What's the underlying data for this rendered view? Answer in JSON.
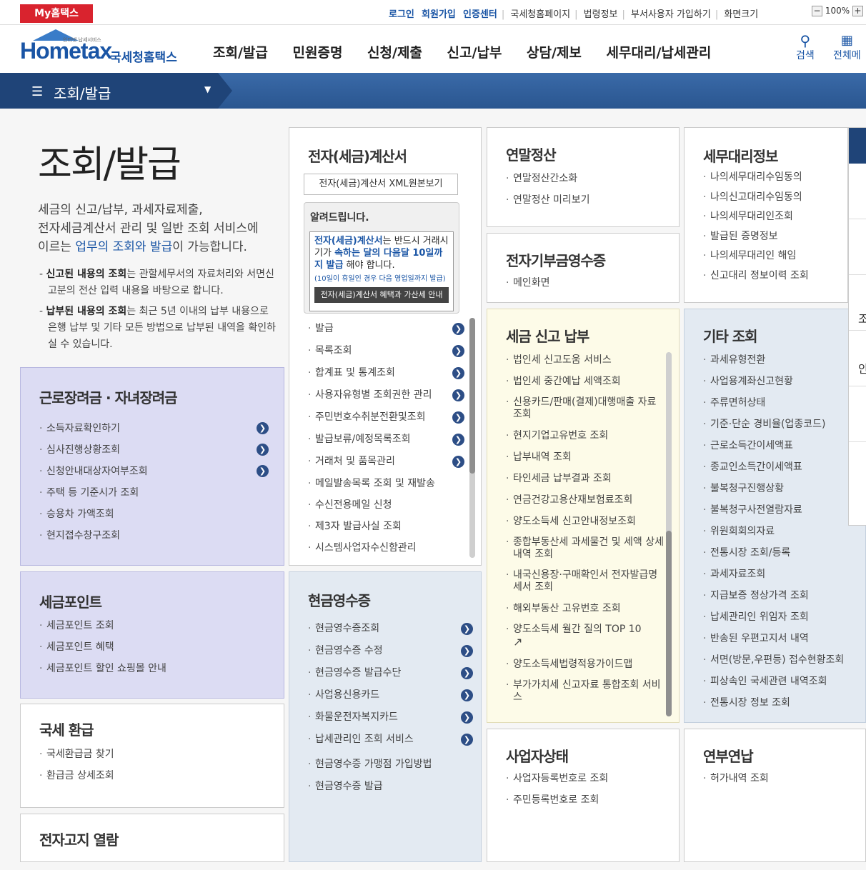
{
  "topbar": {
    "my": "My홈택스",
    "links": [
      "로그인",
      "회원가입",
      "인증센터",
      "국세청홈페이지",
      "법령정보",
      "부서사용자 가입하기",
      "화면크기"
    ],
    "zoom": "100%"
  },
  "logo": {
    "home": "Hometax",
    "sub": "인터넷 납세서비스",
    "kor": "국세청홈택스"
  },
  "nav": [
    "조회/발급",
    "민원증명",
    "신청/제출",
    "신고/납부",
    "상담/제보",
    "세무대리/납세관리"
  ],
  "search_label": "검색",
  "allmenu_label": "전체메",
  "section_title": "조회/발급",
  "intro": {
    "title": "조회/발급",
    "desc_1": "세금의 신고/납부, 과세자료제출,",
    "desc_2": "전자세금계산서 관리 및 일반 조회 서비스에",
    "desc_3a": "이르는 ",
    "desc_3b": "업무의 조회와 발급",
    "desc_3c": "이 가능합니다.",
    "note1_b": "신고된 내용의 조회",
    "note1_t": "는 관할세무서의 자료처리와 서면신고분의 전산 입력 내용을 바탕으로 합니다.",
    "note2_b": "납부된 내용의 조회",
    "note2_t": "는 최근 5년 이내의 납부 내용으로 은행 납부 및 기타 모든 방법으로 납부된 내역을 확인하실 수 있습니다."
  },
  "boxes": {
    "labor": {
      "title": "근로장려금 · 자녀장려금",
      "items": [
        "소득자료확인하기",
        "심사진행상황조회",
        "신청안내대상자여부조회",
        "주택 등 기준시가 조회",
        "승용차 가액조회",
        "현지접수창구조회"
      ]
    },
    "point": {
      "title": "세금포인트",
      "items": [
        "세금포인트 조회",
        "세금포인트 혜택",
        "세금포인트 할인 쇼핑몰 안내"
      ]
    },
    "refund": {
      "title": "국세 환급",
      "items": [
        "국세환급금 찾기",
        "환급금 상세조회"
      ]
    },
    "enotice": {
      "title": "전자고지 열람"
    },
    "einvoice": {
      "title": "전자(세금)계산서",
      "xml_btn": "전자(세금)계산서 XML원본보기",
      "notice_title": "알려드립니다.",
      "notice_body_a": "전자(세금)계산서",
      "notice_body_b": "는 반드시 거래시기가 ",
      "notice_body_c": "속하는 달의 다음달 10일까지 발급",
      "notice_body_d": " 해야 합니다.",
      "notice_small": "(10일이 휴일인 경우 다음 영업일까지 발급)",
      "notice_btn": "전자(세금)계산서 혜택과 가산세 안내",
      "items": [
        "발급",
        "목록조회",
        "합계표 및 통계조회",
        "사용자유형별 조회권한 관리",
        "주민번호수취분전환및조회",
        "발급보류/예정목록조회",
        "거래처 및 품목관리",
        "메일발송목록 조회 및 재발송",
        "수신전용메일 신청",
        "제3자 발급사실 조회",
        "시스템사업자수신함관리"
      ]
    },
    "cash": {
      "title": "현금영수증",
      "items": [
        "현금영수증조회",
        "현금영수증 수정",
        "현금영수증 발급수단",
        "사업용신용카드",
        "화물운전자복지카드",
        "납세관리인 조회 서비스",
        "현금영수증 가맹점 가입방법",
        "현금영수증 발급"
      ]
    },
    "yearend": {
      "title": "연말정산",
      "items": [
        "연말정산간소화",
        "연말정산 미리보기"
      ]
    },
    "donation": {
      "title": "전자기부금영수증",
      "items": [
        "메인화면"
      ]
    },
    "taxreport": {
      "title": "세금 신고 납부",
      "items": [
        "법인세 신고도움 서비스",
        "법인세 중간예납 세액조회",
        "신용카드/판매(결제)대행매출 자료조회",
        "현지기업고유번호 조회",
        "납부내역 조회",
        "타인세금 납부결과 조회",
        "연금건강고용산재보험료조회",
        "양도소득세 신고안내정보조회",
        "종합부동산세 과세물건 및 세액 상세내역 조회",
        "내국신용장·구매확인서 전자발급명세서 조회",
        "해외부동산 고유번호 조회",
        "양도소득세 월간 질의 TOP 10",
        "양도소득세법령적용가이드맵",
        "부가가치세 신고자료 통합조회 서비스"
      ]
    },
    "bizstatus": {
      "title": "사업자상태",
      "items": [
        "사업자등록번호로 조회",
        "주민등록번호로 조회"
      ]
    },
    "agentinfo": {
      "title": "세무대리정보",
      "items": [
        "나의세무대리수임동의",
        "나의신고대리수임동의",
        "나의세무대리인조회",
        "발급된 증명정보",
        "나의세무대리인 해임",
        "신고대리 정보이력 조회"
      ]
    },
    "other": {
      "title": "기타 조회",
      "items": [
        "과세유형전환",
        "사업용계좌신고현황",
        "주류면허상태",
        "기준·단순 경비율(업종코드)",
        "근로소득간이세액표",
        "종교인소득간이세액표",
        "불복청구진행상황",
        "불복청구사전열람자료",
        "위원회회의자료",
        "전통시장 조회/등록",
        "과세자료조회",
        "지급보증 정상가격 조회",
        "납세관리인 위임자 조회",
        "반송된 우편고지서 내역",
        "서면(방문,우편등) 접수현황조회",
        "피상속인 국세관련 내역조회",
        "전통시장 정보 조회"
      ]
    },
    "installment": {
      "title": "연부연납",
      "items": [
        "허가내역 조회"
      ]
    }
  },
  "rightpanel": [
    "조",
    "안"
  ]
}
